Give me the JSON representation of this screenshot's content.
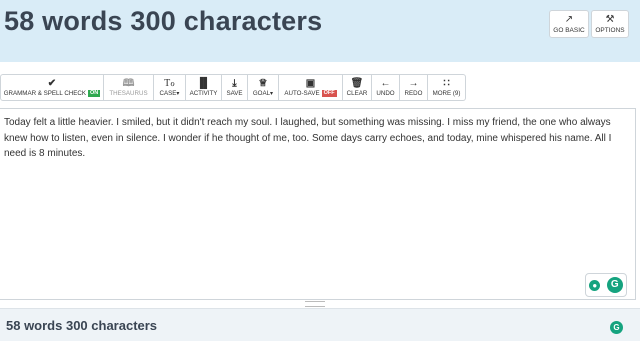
{
  "header": {
    "title": "58 words 300 characters",
    "go_basic_label": "GO BASIC",
    "options_label": "OPTIONS"
  },
  "toolbar": {
    "grammar_label": "GRAMMAR & SPELL CHECK",
    "grammar_state": "ON",
    "thesaurus_label": "THESAURUS",
    "case_label": "CASE",
    "activity_label": "ACTIVITY",
    "save_label": "SAVE",
    "goal_label": "GOAL",
    "autosave_label": "AUTO-SAVE",
    "autosave_state": "OFF",
    "clear_label": "CLEAR",
    "undo_label": "UNDO",
    "redo_label": "REDO",
    "more_label": "MORE (9)"
  },
  "editor": {
    "text": "Today felt a little heavier. I smiled, but it didn't reach my soul. I laughed, but something was missing. I miss my friend, the one who always knew how to listen, even in silence. I wonder if he thought of me, too. Some days carry echoes, and today, mine whispered his name. All I need is  8 minutes."
  },
  "footer": {
    "summary": "58 words 300 characters"
  },
  "colors": {
    "header_bg": "#d9ecf7",
    "on_badge": "#2fa84f",
    "off_badge": "#d9534f",
    "grammarly_green": "#15a37f"
  }
}
